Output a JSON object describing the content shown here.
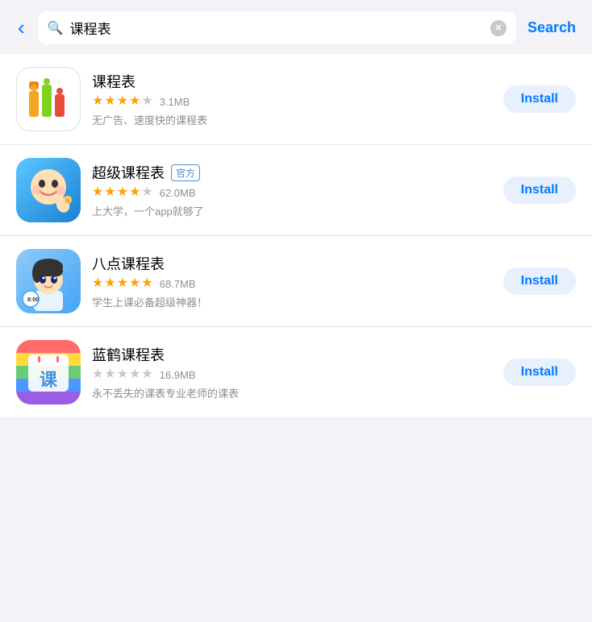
{
  "header": {
    "back_label": "‹",
    "search_value": "课程表",
    "search_button_label": "Search",
    "clear_icon": "✕"
  },
  "apps": [
    {
      "id": "app1",
      "name": "课程表",
      "rating": 3.5,
      "rating_stars": [
        "full",
        "full",
        "full",
        "half",
        "empty"
      ],
      "size": "3.1MB",
      "description": "无广告、速度快的课程表",
      "official": false,
      "install_label": "Install"
    },
    {
      "id": "app2",
      "name": "超级课程表",
      "rating": 4.0,
      "rating_stars": [
        "full",
        "full",
        "full",
        "full",
        "empty"
      ],
      "size": "62.0MB",
      "description": "上大学，一个app就够了",
      "official": true,
      "official_text": "官方",
      "install_label": "Install"
    },
    {
      "id": "app3",
      "name": "八点课程表",
      "rating": 5.0,
      "rating_stars": [
        "full",
        "full",
        "full",
        "full",
        "full"
      ],
      "size": "68.7MB",
      "description": "学生上课必备超级神器！",
      "official": false,
      "install_label": "Install"
    },
    {
      "id": "app4",
      "name": "蓝鹤课程表",
      "rating": 0,
      "rating_stars": [
        "empty",
        "empty",
        "empty",
        "empty",
        "empty"
      ],
      "size": "16.9MB",
      "description": "永不丢失的课表专业老师的课表",
      "official": false,
      "install_label": "Install"
    }
  ]
}
